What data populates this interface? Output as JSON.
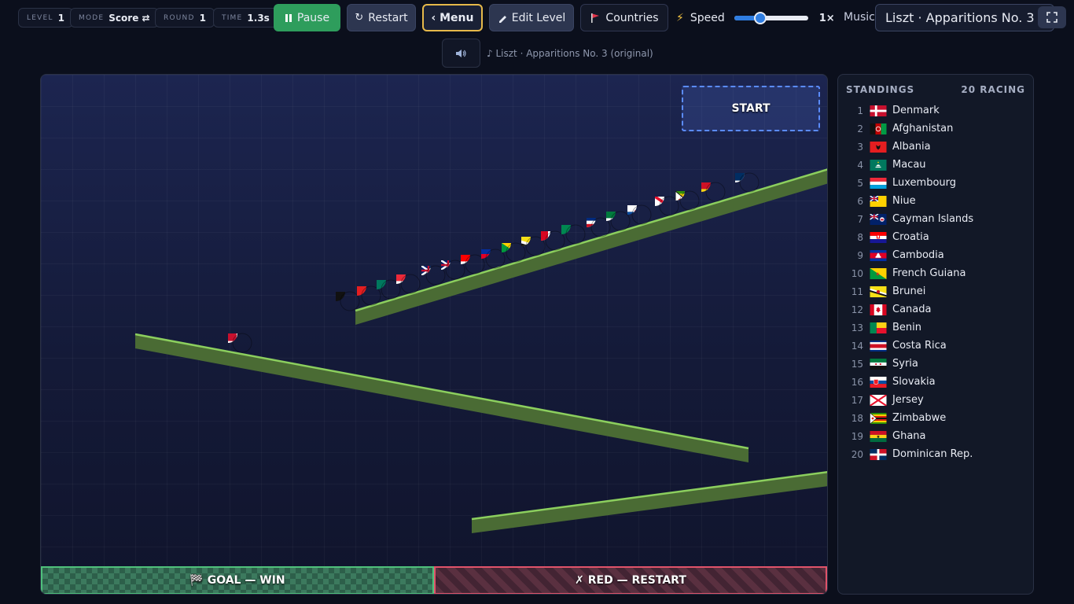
{
  "topbar": {
    "level": {
      "label": "LEVEL",
      "value": "1"
    },
    "mode": {
      "label": "MODE",
      "value": "Score ⇄"
    },
    "round": {
      "label": "ROUND",
      "value": "1"
    },
    "time": {
      "label": "TIME",
      "value": "1.3s"
    },
    "pause_label": "Pause",
    "restart_label": "Restart",
    "menu_label": "‹ Menu",
    "edit_label": "Edit Level",
    "countries_label": "Countries",
    "speed_label": "Speed",
    "speed_fraction": 0.35,
    "speed_value": "1×",
    "music_label": "Music",
    "music_selected": "Liszt · Apparitions No. 3 (original)"
  },
  "now_playing": "♪ Liszt · Apparitions No. 3 (original)",
  "arena": {
    "start_label": "START",
    "goal_label": "🏁 GOAL — WIN",
    "red_label": "✗ RED — RESTART"
  },
  "standings": {
    "title": "STANDINGS",
    "count": "20 RACING",
    "items": [
      {
        "rank": "1",
        "name": "Denmark",
        "flag": "dk"
      },
      {
        "rank": "2",
        "name": "Afghanistan",
        "flag": "af"
      },
      {
        "rank": "3",
        "name": "Albania",
        "flag": "al"
      },
      {
        "rank": "4",
        "name": "Macau",
        "flag": "mo"
      },
      {
        "rank": "5",
        "name": "Luxembourg",
        "flag": "lu"
      },
      {
        "rank": "6",
        "name": "Niue",
        "flag": "nu"
      },
      {
        "rank": "7",
        "name": "Cayman Islands",
        "flag": "ky"
      },
      {
        "rank": "8",
        "name": "Croatia",
        "flag": "hr"
      },
      {
        "rank": "9",
        "name": "Cambodia",
        "flag": "kh"
      },
      {
        "rank": "10",
        "name": "French Guiana",
        "flag": "gf"
      },
      {
        "rank": "11",
        "name": "Brunei",
        "flag": "bn"
      },
      {
        "rank": "12",
        "name": "Canada",
        "flag": "ca"
      },
      {
        "rank": "13",
        "name": "Benin",
        "flag": "bj"
      },
      {
        "rank": "14",
        "name": "Costa Rica",
        "flag": "cr"
      },
      {
        "rank": "15",
        "name": "Syria",
        "flag": "sy"
      },
      {
        "rank": "16",
        "name": "Slovakia",
        "flag": "sk"
      },
      {
        "rank": "17",
        "name": "Jersey",
        "flag": "je"
      },
      {
        "rank": "18",
        "name": "Zimbabwe",
        "flag": "zw"
      },
      {
        "rank": "19",
        "name": "Ghana",
        "flag": "gh"
      },
      {
        "rank": "20",
        "name": "Dominican Rep.",
        "flag": "do"
      }
    ]
  },
  "colors": {
    "accent_green": "#2e9d5c",
    "accent_gold": "#e6b94a",
    "ramp_fill": "#4a6b34",
    "ramp_edge": "#8ccf5e",
    "goal": "#4fc07b",
    "red": "#e0536a"
  }
}
